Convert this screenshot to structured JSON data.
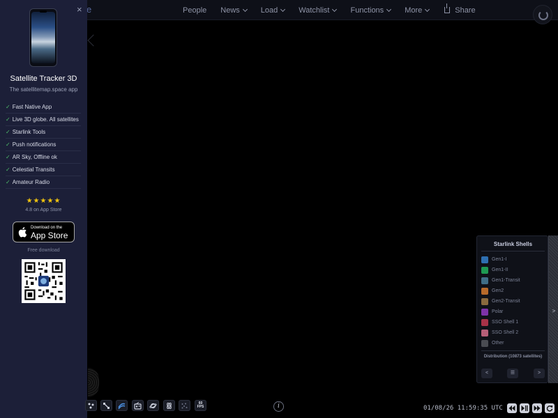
{
  "topbar": {
    "brand_fragment": "e",
    "nav": [
      {
        "label": "People",
        "dropdown": false
      },
      {
        "label": "News",
        "dropdown": true
      },
      {
        "label": "Load",
        "dropdown": true
      },
      {
        "label": "Watchlist",
        "dropdown": true
      },
      {
        "label": "Functions",
        "dropdown": true
      },
      {
        "label": "More",
        "dropdown": true
      }
    ],
    "share_label": "Share"
  },
  "promo": {
    "close_glyph": "×",
    "title": "Satellite Tracker 3D",
    "subtitle": "The satellitemap.space app",
    "features": [
      "Fast Native App",
      "Live 3D globe. All satellites",
      "Starlink Tools",
      "Push notifications",
      "AR Sky, Offline ok",
      "Celestial Transits",
      "Amateur Radio"
    ],
    "check_glyph": "✓",
    "stars": "★★★★★",
    "rating_text": "4.8 on App Store",
    "appstore_small": "Download on the",
    "appstore_big": "App Store",
    "free_text": "Free download"
  },
  "shells_panel": {
    "title": "Starlink Shells",
    "items": [
      {
        "label": "Gen1-I",
        "color": "#2e6fb0"
      },
      {
        "label": "Gen1-II",
        "color": "#1e9a52"
      },
      {
        "label": "Gen1-Transit",
        "color": "#3f6d86"
      },
      {
        "label": "Gen2",
        "color": "#b76a2a"
      },
      {
        "label": "Gen2-Transit",
        "color": "#8a6a3e"
      },
      {
        "label": "Polar",
        "color": "#7e33a8"
      },
      {
        "label": "SSO Shell 1",
        "color": "#a83248"
      },
      {
        "label": "SSO Shell 2",
        "color": "#b65f78"
      },
      {
        "label": "Other",
        "color": "#4a4c52"
      }
    ],
    "distribution": "Distribution (10873 satellites)",
    "prev_label": "<",
    "menu_label": "☰",
    "next_label": ">",
    "side_tab_arrow": ">"
  },
  "toolbar": {
    "fps_top": "60",
    "fps_bottom": "FPS",
    "info_label": "i"
  },
  "clock": {
    "datetime": "01/08/26  11:59:35 UTC"
  }
}
